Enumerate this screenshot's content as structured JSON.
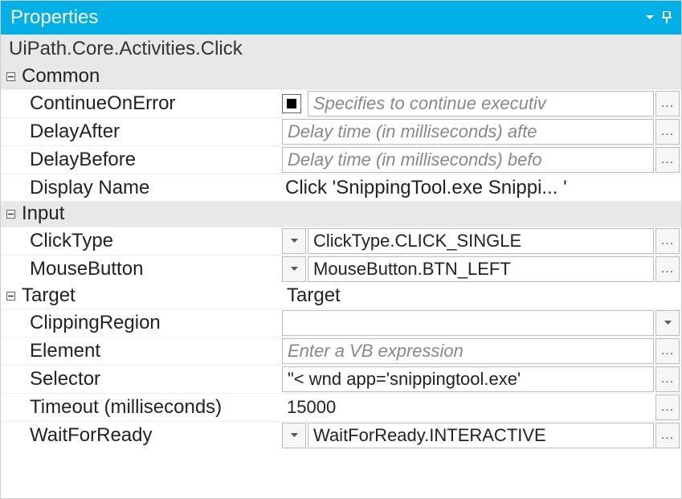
{
  "panel": {
    "title": "Properties"
  },
  "header": {
    "class_name": "UiPath.Core.Activities.Click"
  },
  "categories": {
    "common": {
      "label": "Common",
      "props": {
        "continue_on_error": {
          "label": "ContinueOnError",
          "placeholder": "Specifies to continue executiv"
        },
        "delay_after": {
          "label": "DelayAfter",
          "placeholder": "Delay time (in milliseconds) afte"
        },
        "delay_before": {
          "label": "DelayBefore",
          "placeholder": "Delay time (in milliseconds) befo"
        },
        "display_name": {
          "label": "Display Name",
          "value": "Click 'SnippingTool.exe Snippi... '"
        }
      }
    },
    "input": {
      "label": "Input",
      "props": {
        "click_type": {
          "label": "ClickType",
          "value": "ClickType.CLICK_SINGLE"
        },
        "mouse_button": {
          "label": "MouseButton",
          "value": "MouseButton.BTN_LEFT"
        }
      }
    },
    "target": {
      "label": "Target",
      "value": "Target",
      "props": {
        "clipping_region": {
          "label": "ClippingRegion",
          "value": ""
        },
        "element": {
          "label": "Element",
          "placeholder": "Enter a VB expression"
        },
        "selector": {
          "label": "Selector",
          "value": "\"< wnd app='snippingtool.exe' "
        },
        "timeout": {
          "label": "Timeout (milliseconds)",
          "value": "15000"
        },
        "wait_for_ready": {
          "label": "WaitForReady",
          "value": "WaitForReady.INTERACTIVE"
        }
      }
    }
  },
  "buttons": {
    "ellipsis": "...",
    "dropdown": "▾"
  }
}
